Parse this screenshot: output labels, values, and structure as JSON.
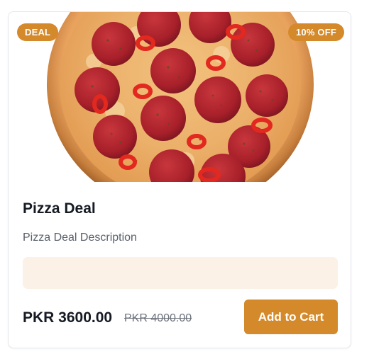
{
  "product": {
    "badge_left": "DEAL",
    "badge_right": "10% OFF",
    "title": "Pizza Deal",
    "description": "Pizza Deal Description",
    "price": "PKR 3600.00",
    "old_price": "PKR 4000.00",
    "add_to_cart_label": "Add to Cart",
    "image": "pepperoni-pizza-photo"
  },
  "colors": {
    "accent": "#d4892a",
    "info_box": "#fbf1e6",
    "title_text": "#151a23",
    "muted_text": "#5a606b"
  }
}
